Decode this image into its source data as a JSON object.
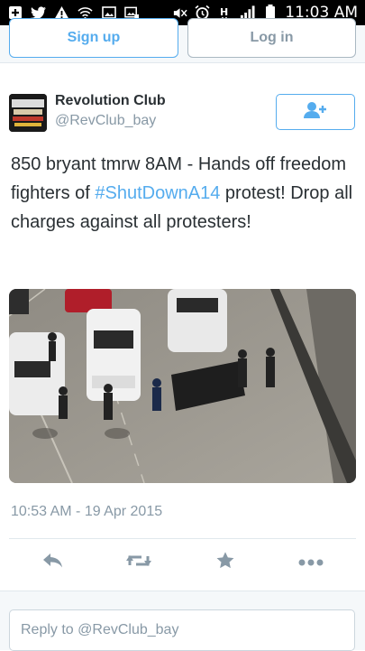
{
  "status_bar": {
    "time": "11:03 AM",
    "icons": [
      "plus-box-icon",
      "twitter-bird-icon",
      "warning-icon",
      "wifi-icon",
      "image-icon",
      "gallery-icon",
      "mute-icon",
      "alarm-icon",
      "hspa-icon",
      "signal-icon",
      "battery-icon"
    ]
  },
  "top_buttons": {
    "signup_label": "Sign up",
    "login_label": "Log in"
  },
  "tweet": {
    "display_name": "Revolution Club",
    "handle": "@RevClub_bay",
    "text_before": "850 bryant tmrw 8AM - Hands off freedom fighters of ",
    "hashtag": "#ShutDownA14",
    "text_after": " protest! Drop all charges against all protesters!",
    "timestamp": "10:53 AM - 19 Apr 2015",
    "colors": {
      "accent": "#55acee",
      "text": "#292f33",
      "muted": "#8899a6"
    }
  },
  "actions": [
    "reply-icon",
    "retweet-icon",
    "favorite-icon",
    "more-icon"
  ],
  "reply": {
    "placeholder": "Reply to @RevClub_bay"
  }
}
